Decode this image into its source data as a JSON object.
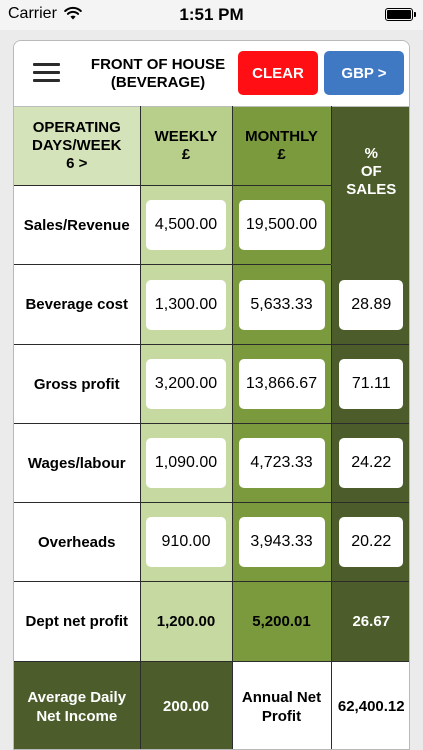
{
  "status_bar": {
    "carrier": "Carrier",
    "time": "1:51 PM",
    "icons": [
      "wifi-icon",
      "battery-icon"
    ]
  },
  "header": {
    "title_line1": "FRONT OF HOUSE",
    "title_line2": "(BEVERAGE)",
    "clear_label": "CLEAR",
    "currency_label": "GBP >",
    "menu_icon": "hamburger-menu-icon"
  },
  "colors": {
    "clear_button": "#ff0f14",
    "currency_button": "#3f79c4",
    "weekly_column": "#b7cf8a",
    "monthly_column": "#7a9a3d",
    "percent_column": "#4c5d2b",
    "label_header": "#d4e3b9"
  },
  "table": {
    "headers": {
      "operating_line1": "OPERATING",
      "operating_line2": "DAYS/WEEK",
      "operating_line3": "6 >",
      "weekly_line1": "WEEKLY",
      "weekly_line2": "£",
      "monthly_line1": "MONTHLY",
      "monthly_line2": "£",
      "percent_line1": "%",
      "percent_line2": "OF",
      "percent_line3": "SALES"
    },
    "rows": [
      {
        "label": "Sales/Revenue",
        "weekly": "4,500.00",
        "monthly": "19,500.00",
        "percent": ""
      },
      {
        "label": "Beverage cost",
        "weekly": "1,300.00",
        "monthly": "5,633.33",
        "percent": "28.89"
      },
      {
        "label": "Gross profit",
        "weekly": "3,200.00",
        "monthly": "13,866.67",
        "percent": "71.11"
      },
      {
        "label": "Wages/labour",
        "weekly": "1,090.00",
        "monthly": "4,723.33",
        "percent": "24.22"
      },
      {
        "label": "Overheads",
        "weekly": "910.00",
        "monthly": "3,943.33",
        "percent": "20.22"
      }
    ],
    "net_profit": {
      "label": "Dept net profit",
      "weekly": "1,200.00",
      "monthly": "5,200.01",
      "percent": "26.67"
    },
    "footer": {
      "daily_label_line1": "Average Daily",
      "daily_label_line2": "Net Income",
      "daily_value": "200.00",
      "annual_label_line1": "Annual Net",
      "annual_label_line2": "Profit",
      "annual_value": "62,400.12"
    }
  }
}
